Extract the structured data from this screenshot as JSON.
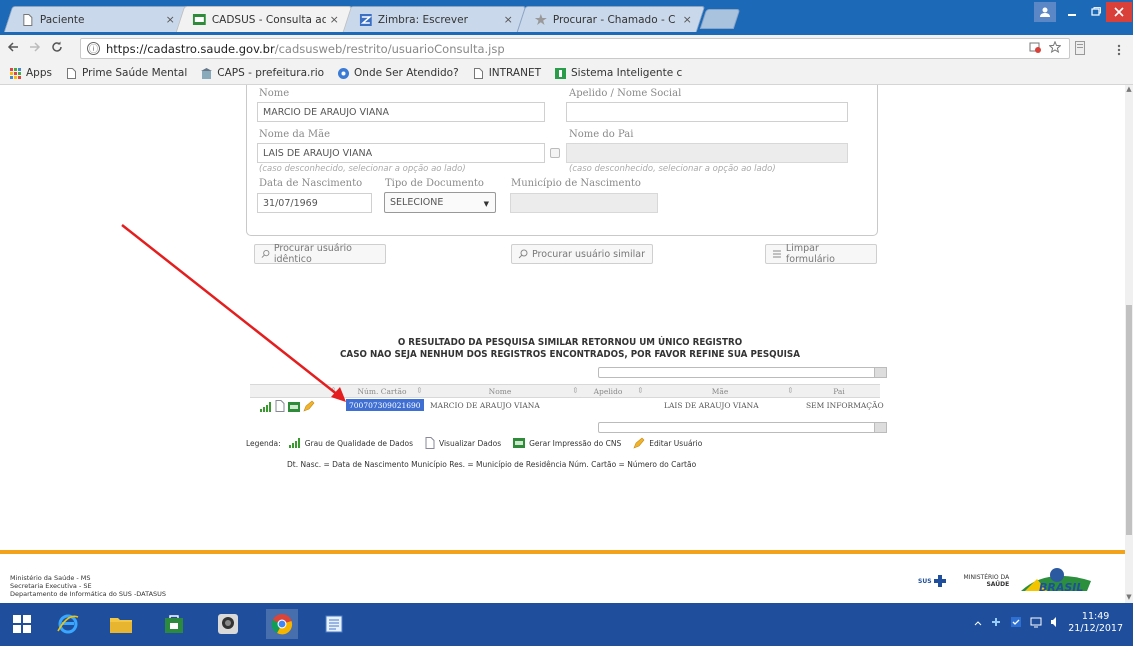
{
  "tabs": [
    {
      "title": "Paciente",
      "close": "×"
    },
    {
      "title": "CADSUS - Consulta ao C",
      "close": "×"
    },
    {
      "title": "Zimbra: Escrever",
      "close": "×"
    },
    {
      "title": "Procurar - Chamado - C",
      "close": "×"
    }
  ],
  "address": {
    "info": "ⓘ",
    "host": "https://cadastro.saude.gov.br",
    "path": "/cadsusweb/restrito/usuarioConsulta.jsp"
  },
  "bookmarks": [
    "Apps",
    "Prime Saúde Mental",
    "CAPS - prefeitura.rio",
    "Onde Ser Atendido?",
    "INTRANET",
    "Sistema Inteligente c"
  ],
  "form": {
    "nome_label": "Nome",
    "nome_value": "MARCIO DE ARAUJO VIANA",
    "apelido_label": "Apelido / Nome Social",
    "apelido_value": "",
    "mae_label": "Nome da Mãe",
    "mae_value": "LAIS DE ARAUJO VIANA",
    "mae_hint": "(caso desconhecido, selecionar a opção ao lado)",
    "pai_label": "Nome do Pai",
    "pai_value": "",
    "pai_hint": "(caso desconhecido, selecionar a opção ao lado)",
    "nasc_label": "Data de Nascimento",
    "nasc_value": "31/07/1969",
    "tipo_doc_label": "Tipo de Documento",
    "tipo_doc_value": "SELECIONE",
    "municipio_label": "Município de Nascimento",
    "municipio_value": ""
  },
  "buttons": {
    "identico": "Procurar usuário idêntico",
    "similar": "Procurar usuário similar",
    "limpar": "Limpar formulário"
  },
  "result": {
    "line1": "O RESULTADO DA PESQUISA SIMILAR RETORNOU UM ÚNICO REGISTRO",
    "line2": "CASO NÃO SEJA NENHUM DOS REGISTROS ENCONTRADOS, POR FAVOR REFINE SUA PESQUISA"
  },
  "grid": {
    "headers": [
      "Núm. Cartão",
      "Nome",
      "Apelido",
      "Mãe",
      "Pai"
    ],
    "row": {
      "cartao": "700707309021690",
      "nome": "MARCIO DE ARAUJO VIANA",
      "apelido": "",
      "mae": "LAIS DE ARAUJO VIANA",
      "pai": "SEM INFORMAÇÃO"
    }
  },
  "legend": {
    "title": "Legenda:",
    "items": [
      "Grau de Qualidade de Dados",
      "Visualizar Dados",
      "Gerar Impressão do CNS",
      "Editar Usuário"
    ],
    "abbrev": "Dt. Nasc. = Data de Nascimento   Município Res. = Município de Residência   Núm. Cartão = Número do Cartão"
  },
  "footer": {
    "lines": [
      "Ministério da Saúde - MS",
      "Secretaria Executiva - SE",
      "Departamento de Informática do SUS -DATASUS"
    ],
    "ministerio": "MINISTÉRIO DA",
    "saude": "SAÚDE",
    "sus": "SUS"
  },
  "clock": {
    "time": "11:49",
    "date": "21/12/2017"
  },
  "colors": {
    "accent": "#f3a31b",
    "tabstrip": "#1c69b8",
    "taskbar": "#1f4f9c",
    "selection": "#3f6fd3",
    "arrow": "#e41e1e"
  }
}
